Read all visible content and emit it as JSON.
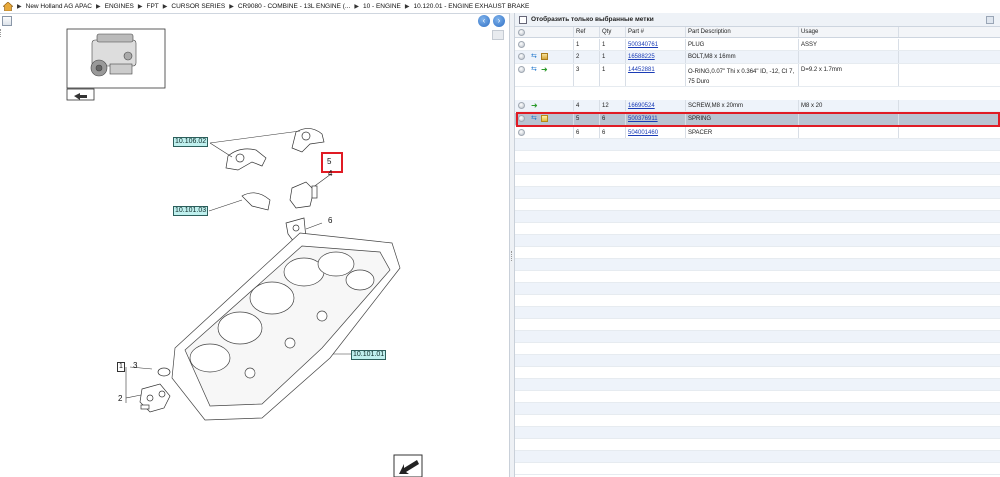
{
  "breadcrumb": {
    "items": [
      "New Holland AG APAC",
      "ENGINES",
      "FPT",
      "CURSOR SERIES",
      "CR9080 - COMBINE - 13L ENGINE (...",
      "10 - ENGINE",
      "10.120.01 - ENGINE EXHAUST BRAKE"
    ]
  },
  "drawing": {
    "callouts": [
      "10.106.02",
      "10.101.03",
      "10.101.01"
    ],
    "ref_numbers": [
      "5",
      "4",
      "6",
      "3",
      "2",
      "1"
    ]
  },
  "filter": {
    "label": "Отобразить только выбранные метки"
  },
  "table": {
    "headers": {
      "ref": "Ref",
      "qty": "Qty",
      "part": "Part #",
      "desc": "Part Description",
      "usage": "Usage"
    },
    "rows": [
      {
        "ref": "1",
        "qty": "1",
        "part": "500340761",
        "desc": "PLUG",
        "usage": "ASSY"
      },
      {
        "ref": "2",
        "qty": "1",
        "part": "16588225",
        "desc": "BOLT,M8 x 16mm",
        "usage": ""
      },
      {
        "ref": "3",
        "qty": "1",
        "part": "14452881",
        "desc": "O-RING,0.07\" Thi x 0.364\" ID, -12, CI 7, 75 Duro",
        "usage": "D=9.2 x 1.7mm"
      },
      {
        "ref": "4",
        "qty": "12",
        "part": "16690524",
        "desc": "SCREW,M8 x 20mm",
        "usage": "M8 x 20"
      },
      {
        "ref": "5",
        "qty": "6",
        "part": "500376911",
        "desc": "SPRING",
        "usage": ""
      },
      {
        "ref": "6",
        "qty": "6",
        "part": "504001460",
        "desc": "SPACER",
        "usage": ""
      }
    ]
  },
  "colors": {
    "highlight": "#e01b24",
    "callout_bg": "#bff0ee",
    "link": "#1a3cb6",
    "selected_row": "#b9c4d1"
  }
}
